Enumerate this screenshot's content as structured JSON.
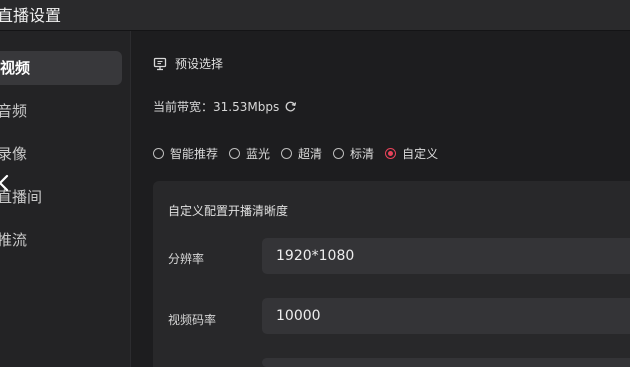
{
  "window": {
    "title": "直播设置"
  },
  "sidebar": {
    "items": [
      {
        "label": "视频",
        "active": true
      },
      {
        "label": "音频",
        "active": false
      },
      {
        "label": "录像",
        "active": false
      },
      {
        "label": "直播间",
        "active": false
      },
      {
        "label": "推流",
        "active": false
      }
    ],
    "back_icon": "chevron-left-icon"
  },
  "main": {
    "section_title": "预设选择",
    "section_icon": "monitor-icon",
    "bandwidth_label": "当前带宽：31.53Mbps",
    "refresh_icon": "refresh-icon",
    "presets": [
      {
        "label": "智能推荐",
        "checked": false
      },
      {
        "label": "蓝光",
        "checked": false
      },
      {
        "label": "超清",
        "checked": false
      },
      {
        "label": "标清",
        "checked": false
      },
      {
        "label": "自定义",
        "checked": true
      }
    ],
    "custom_panel": {
      "title": "自定义配置开播清晰度",
      "fields": [
        {
          "label": "分辨率",
          "value": "1920*1080"
        },
        {
          "label": "视频码率",
          "value": "10000"
        },
        {
          "label": "",
          "value": ""
        }
      ]
    }
  },
  "colors": {
    "accent": "#e8435a",
    "background": "#1d1d1f",
    "sidebar_active": "#38383b",
    "field_background": "#343437"
  }
}
